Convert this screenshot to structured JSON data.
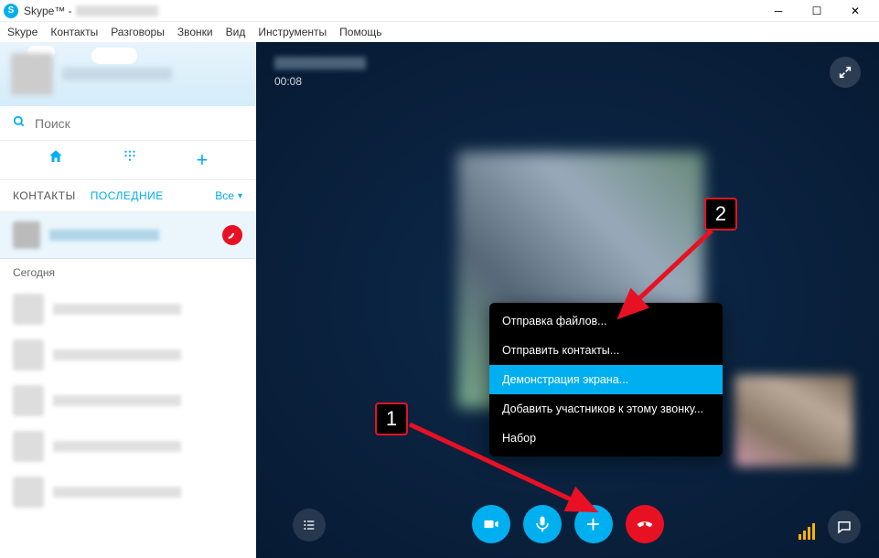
{
  "window": {
    "app_title": "Skype™ -"
  },
  "menu": [
    "Skype",
    "Контакты",
    "Разговоры",
    "Звонки",
    "Вид",
    "Инструменты",
    "Помощь"
  ],
  "search": {
    "placeholder": "Поиск"
  },
  "tabs": {
    "contacts": "КОНТАКТЫ",
    "recents": "ПОСЛЕДНИЕ",
    "filter": "Все"
  },
  "section_today": "Сегодня",
  "call": {
    "timer": "00:08"
  },
  "dropdown": {
    "items": [
      "Отправка файлов...",
      "Отправить контакты...",
      "Демонстрация экрана...",
      "Добавить участников к этому звонку...",
      "Набор"
    ],
    "highlighted_index": 2
  },
  "annotation": {
    "one": "1",
    "two": "2"
  }
}
